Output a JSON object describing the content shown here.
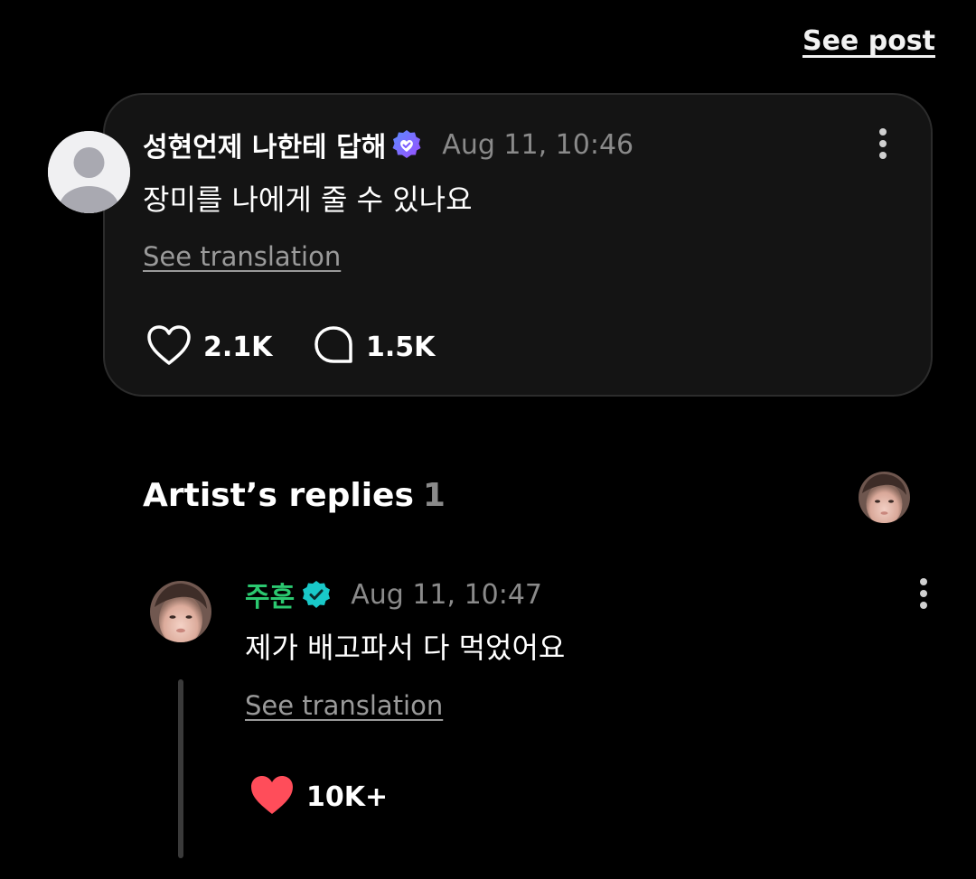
{
  "header": {
    "see_post_label": "See post"
  },
  "post": {
    "author": "성현언제 나한테 답해",
    "timestamp": "Aug 11, 10:46",
    "text": "장미를 나에게 줄 수 있나요",
    "see_translation": "See translation",
    "likes": "2.1K",
    "comments": "1.5K",
    "badge_color": "#7b5cff"
  },
  "artist_replies": {
    "title": "Artist’s replies",
    "count": "1"
  },
  "reply": {
    "author": "주훈",
    "timestamp": "Aug 11, 10:47",
    "text": "제가 배고파서 다 먹었어요",
    "see_translation": "See translation",
    "likes": "10K+",
    "author_color": "#2bc870",
    "heart_color": "#ff4d5a",
    "badge_color": "#19c8c8"
  },
  "icons": {
    "default_avatar": "person-silhouette-icon",
    "verified_post": "heart-check-badge-icon",
    "verified_artist": "check-badge-icon",
    "more": "kebab-icon",
    "like": "heart-outline-icon",
    "comment": "comment-bubble-icon",
    "liked": "heart-filled-icon"
  }
}
